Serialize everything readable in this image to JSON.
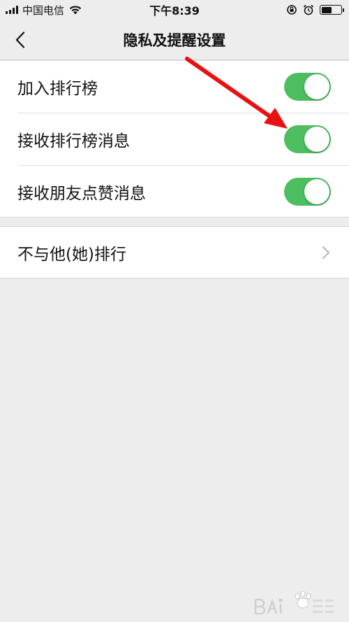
{
  "status_bar": {
    "carrier": "中国电信",
    "time": "下午8:39",
    "battery_level": 0.55
  },
  "nav": {
    "title": "隐私及提醒设置",
    "back_icon": "chevron-left-icon"
  },
  "settings_group_1": [
    {
      "label": "加入排行榜",
      "enabled": true
    },
    {
      "label": "接收排行榜消息",
      "enabled": true
    },
    {
      "label": "接收朋友点赞消息",
      "enabled": true
    }
  ],
  "settings_group_2": [
    {
      "label": "不与他(她)排行",
      "icon": "chevron-right-icon"
    }
  ],
  "colors": {
    "switch_on": "#4cbe60",
    "background": "#ededed",
    "annotation": "#e81212"
  }
}
